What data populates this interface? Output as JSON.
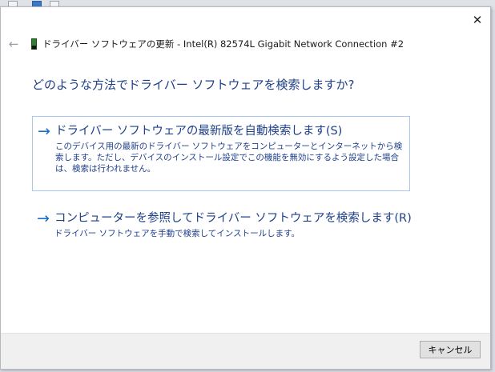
{
  "dialog": {
    "title": "ドライバー ソフトウェアの更新 - Intel(R) 82574L Gigabit Network Connection #2",
    "close_symbol": "✕",
    "back_symbol": "←",
    "question": "どのような方法でドライバー ソフトウェアを検索しますか?"
  },
  "options": [
    {
      "title": "ドライバー ソフトウェアの最新版を自動検索します(S)",
      "description": "このデバイス用の最新のドライバー ソフトウェアをコンピューターとインターネットから検索します。ただし、デバイスのインストール設定でこの機能を無効にするよう設定した場合は、検索は行われません。",
      "arrow": "→"
    },
    {
      "title": "コンピューターを参照してドライバー ソフトウェアを検索します(R)",
      "description": "ドライバー ソフトウェアを手動で検索してインストールします。",
      "arrow": "→"
    }
  ],
  "footer": {
    "cancel_label": "キャンセル"
  },
  "icons": {
    "back": "back-arrow-icon",
    "device": "network-device-icon",
    "close": "close-icon"
  },
  "colors": {
    "link": "#1e3f8a",
    "arrow": "#1a6fc9",
    "selection_border": "#a9c8eb"
  }
}
